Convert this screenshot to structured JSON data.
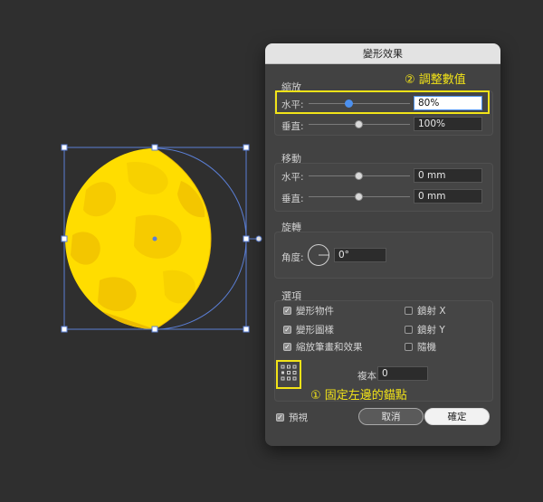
{
  "dialog": {
    "title": "變形效果",
    "scale": {
      "title": "縮放",
      "horizontal_label": "水平:",
      "horizontal_value": "80%",
      "vertical_label": "垂直:",
      "vertical_value": "100%"
    },
    "move": {
      "title": "移動",
      "horizontal_label": "水平:",
      "horizontal_value": "0 mm",
      "vertical_label": "垂直:",
      "vertical_value": "0 mm"
    },
    "rotate": {
      "title": "旋轉",
      "angle_label": "角度:",
      "angle_value": "0°"
    },
    "options": {
      "title": "選項",
      "items": [
        {
          "label": "變形物件",
          "checked": true
        },
        {
          "label": "鏡射 X",
          "checked": false
        },
        {
          "label": "變形圖樣",
          "checked": true
        },
        {
          "label": "鏡射 Y",
          "checked": false
        },
        {
          "label": "縮放筆畫和效果",
          "checked": true
        },
        {
          "label": "隨機",
          "checked": false
        }
      ]
    },
    "copies_label": "複本",
    "copies_value": "0",
    "preview_label": "預視",
    "cancel_label": "取消",
    "ok_label": "確定"
  },
  "annotations": {
    "step1": "① 固定左邊的錨點",
    "step2": "② 調整數值"
  },
  "colors": {
    "highlight": "#f2e318",
    "selection": "#5b7fd6",
    "moon_fill": "#ffdd00"
  }
}
